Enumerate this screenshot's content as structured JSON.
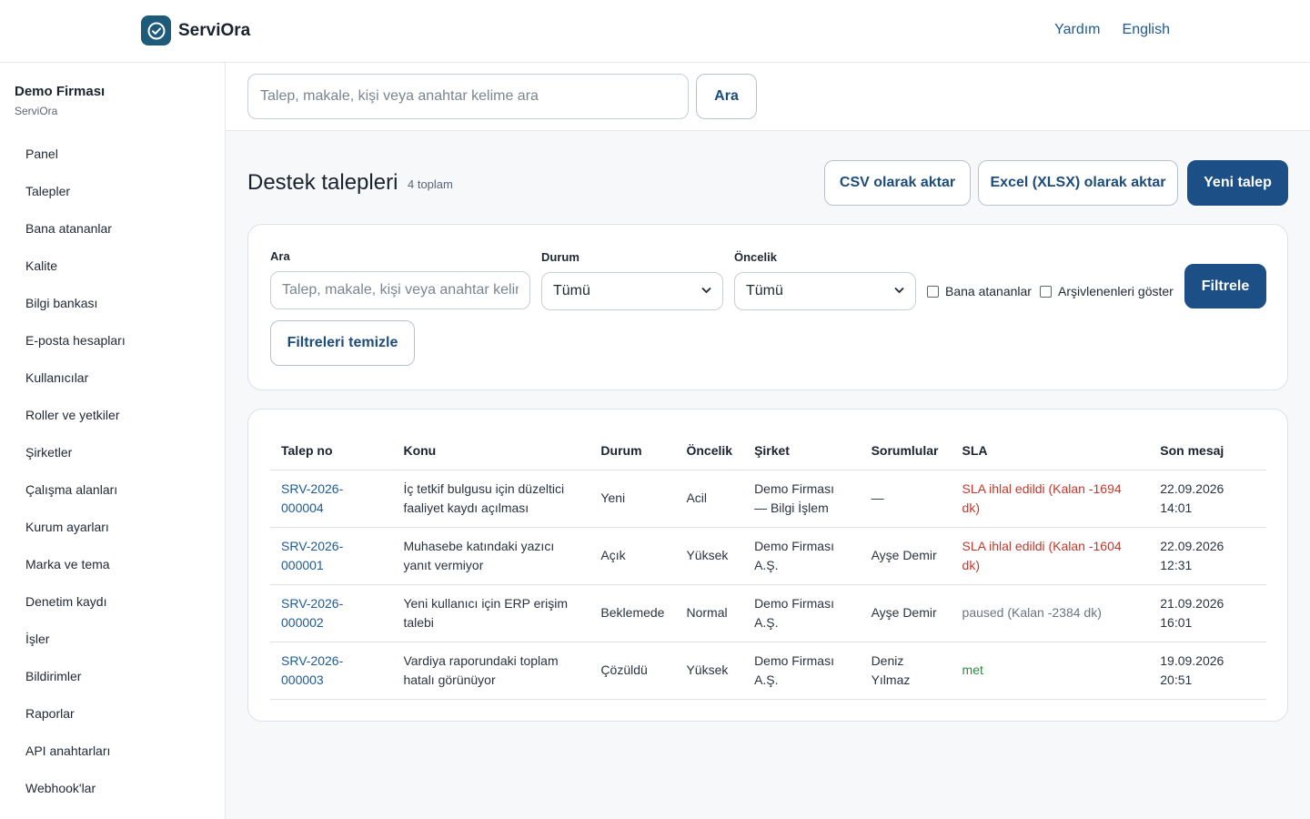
{
  "app": {
    "brand": "ServiOra",
    "top_links": [
      "Yardım",
      "English"
    ]
  },
  "sidebar": {
    "org_name": "Demo Firması",
    "org_sub": "ServiOra",
    "items": [
      {
        "label": "Panel"
      },
      {
        "label": "Talepler"
      },
      {
        "label": "Bana atananlar"
      },
      {
        "label": "Kalite"
      },
      {
        "label": "Bilgi bankası"
      },
      {
        "label": "E-posta hesapları"
      },
      {
        "label": "Kullanıcılar"
      },
      {
        "label": "Roller ve yetkiler"
      },
      {
        "label": "Şirketler"
      },
      {
        "label": "Çalışma alanları"
      },
      {
        "label": "Kurum ayarları"
      },
      {
        "label": "Marka ve tema"
      },
      {
        "label": "Denetim kaydı"
      },
      {
        "label": "İşler"
      },
      {
        "label": "Bildirimler"
      },
      {
        "label": "Raporlar"
      },
      {
        "label": "API anahtarları"
      },
      {
        "label": "Webhook'lar"
      }
    ]
  },
  "search": {
    "placeholder": "Talep, makale, kişi veya anahtar kelime ara",
    "button": "Ara"
  },
  "page": {
    "title": "Destek talepleri",
    "count": "4 toplam",
    "csv_button": "CSV olarak aktar",
    "xlsx_button": "Excel (XLSX) olarak aktar",
    "new_button": "Yeni talep"
  },
  "filters": {
    "search_label": "Ara",
    "search_placeholder": "Talep, makale, kişi veya anahtar kelime ara",
    "status_label": "Durum",
    "status_value": "Tümü",
    "priority_label": "Öncelik",
    "priority_value": "Tümü",
    "assigned_label": "Bana atananlar",
    "archived_label": "Arşivlenenleri göster",
    "filter_button": "Filtrele",
    "clear_button": "Filtreleri temizle"
  },
  "table": {
    "headers": [
      "Talep no",
      "Konu",
      "Durum",
      "Öncelik",
      "Şirket",
      "Sorumlular",
      "SLA",
      "Son mesaj"
    ],
    "rows": [
      {
        "id": "SRV-2026-000004",
        "subject": "İç tetkif bulgusu için düzeltici faaliyet kaydı açılması",
        "status": "Yeni",
        "priority": "Acil",
        "company": "Demo Firması — Bilgi İşlem",
        "assignees": "—",
        "sla": "SLA ihlal edildi (Kalan -1694 dk)",
        "sla_state": "bad",
        "last": "22.09.2026 14:01"
      },
      {
        "id": "SRV-2026-000001",
        "subject": "Muhasebe katındaki yazıcı yanıt vermiyor",
        "status": "Açık",
        "priority": "Yüksek",
        "company": "Demo Firması A.Ş.",
        "assignees": "Ayşe Demir",
        "sla": "SLA ihlal edildi (Kalan -1604 dk)",
        "sla_state": "bad",
        "last": "22.09.2026 12:31"
      },
      {
        "id": "SRV-2026-000002",
        "subject": "Yeni kullanıcı için ERP erişim talebi",
        "status": "Beklemede",
        "priority": "Normal",
        "company": "Demo Firması A.Ş.",
        "assignees": "Ayşe Demir",
        "sla": "paused (Kalan -2384 dk)",
        "sla_state": "paused",
        "last": "21.09.2026 16:01"
      },
      {
        "id": "SRV-2026-000003",
        "subject": "Vardiya raporundaki toplam hatalı görünüyor",
        "status": "Çözüldü",
        "priority": "Yüksek",
        "company": "Demo Firması A.Ş.",
        "assignees": "Deniz Yılmaz",
        "sla": "met",
        "sla_state": "ok",
        "last": "19.09.2026 20:51"
      }
    ]
  }
}
